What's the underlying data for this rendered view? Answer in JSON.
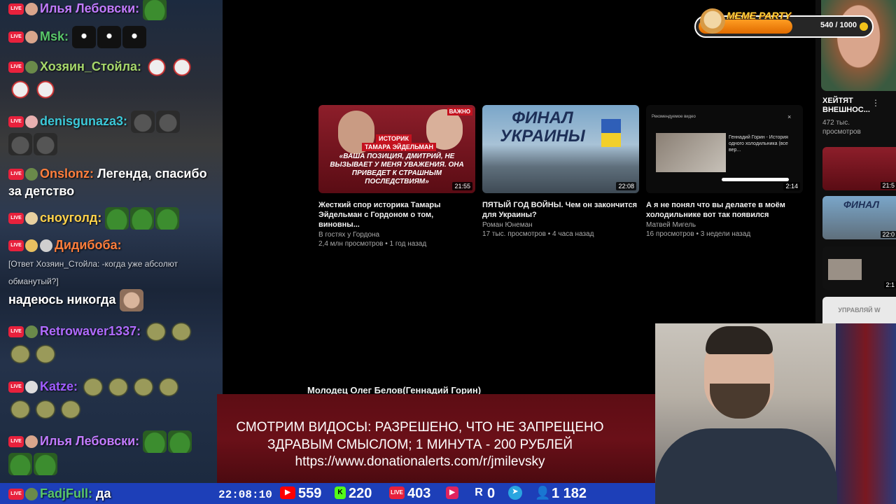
{
  "chat": {
    "messages": [
      {
        "user": "Илья Лебовски:",
        "color": "#c27bff",
        "text": ""
      },
      {
        "user": "Msk:",
        "color": "#59c76a",
        "text": ""
      },
      {
        "user": "Хозяин_Стойла:",
        "color": "#a6d76b",
        "text": ""
      },
      {
        "user": "denisgunaza3:",
        "color": "#3cc8d8",
        "text": ""
      },
      {
        "user": "Onslonz:",
        "color": "#ff7e3c",
        "text": "Легенда, спасибо за детство"
      },
      {
        "user": "сноуголд:",
        "color": "#ffd24a",
        "text": ""
      },
      {
        "user": "Дидибоба:",
        "color": "#ff7e3c",
        "reply": "[Ответ Хозяин_Стойла: -когда уже абсолют обманутый?]",
        "text": "надеюсь никогда"
      },
      {
        "user": "Retrowaver1337:",
        "color": "#b06bff",
        "text": ""
      },
      {
        "user": "Katze:",
        "color": "#9f5cff",
        "text": ""
      },
      {
        "user": "Илья Лебовски:",
        "color": "#c27bff",
        "text": ""
      },
      {
        "user": "FadjFull:",
        "color": "#59c76a",
        "text": "да"
      }
    ]
  },
  "videos": [
    {
      "title": "Жесткий спор историка Тамары Эйдельман с Гордоном о том, виновны...",
      "channel": "В гостях у Гордона",
      "meta": "2,4 млн просмотров • 1 год назад",
      "duration": "21:55",
      "thumb_badge": "ВАЖНО",
      "thumb_caption": "«ВАША ПОЗИЦИЯ, ДМИТРИЙ, НЕ ВЫЗЫВАЕТ У МЕНЯ УВАЖЕНИЯ. ОНА ПРИВЕДЕТ К СТРАШНЫМ ПОСЛЕДСТВИЯМ»",
      "thumb_label1": "ИСТОРИК",
      "thumb_label2": "ТАМАРА ЭЙДЕЛЬМАН"
    },
    {
      "title": "ПЯТЫЙ ГОД ВОЙНЫ. Чем он закончится для Украины?",
      "channel": "Роман Юнеман",
      "meta": "17 тыс. просмотров • 4 часа назад",
      "duration": "22:08",
      "thumb_caption": "ФИНАЛ УКРАИНЫ"
    },
    {
      "title": "А я не понял что вы делаете в моём холодильнике вот так появился",
      "channel": "Матвей Мигель",
      "meta": "16 просмотров • 3 недели назад",
      "duration": "2:14",
      "thumb_caption": "Рекомендуемое видео",
      "thumb_sub": "Геннадий Горин - История одного холодильника (все вер..."
    }
  ],
  "right_column": {
    "item1_title": "ХЕЙТЯТ ВНЕШНОС...",
    "item1_views": "472 тыс. просмотров",
    "item1_duration_partial": "21:5",
    "item2_caption": "ФИНАЛ",
    "item2_duration_partial": "22:0",
    "item3_duration_partial": "2:1",
    "item4_label": "УПРАВЛЯЙ W"
  },
  "below_title": "Молодец Олег Белов(Геннадий Горин)",
  "banner": {
    "line1": "СМОТРИМ ВИДОСЫ: РАЗРЕШЕНО, ЧТО НЕ ЗАПРЕЩЕНО",
    "line2": "ЗДРАВЫМ СМЫСЛОМ; 1 МИНУТА - 200 РУБЛЕЙ",
    "line3": "https://www.donationalerts.com/r/jmilevsky"
  },
  "meme_party": {
    "label": "MEME PARTY",
    "progress_text": "540 / 1000",
    "progress": 0.54
  },
  "bottom_bar": {
    "time": "22:08:10",
    "youtube": "559",
    "kick": "220",
    "vk": "403",
    "rumble_or_other": "0",
    "twitch_badge": "R",
    "viewers": "1 182"
  },
  "colors": {
    "accent_red": "#e8213c",
    "bar_blue": "#1d3fb8",
    "banner_red": "#5d0d14",
    "meme_orange": "#ff9d22"
  }
}
